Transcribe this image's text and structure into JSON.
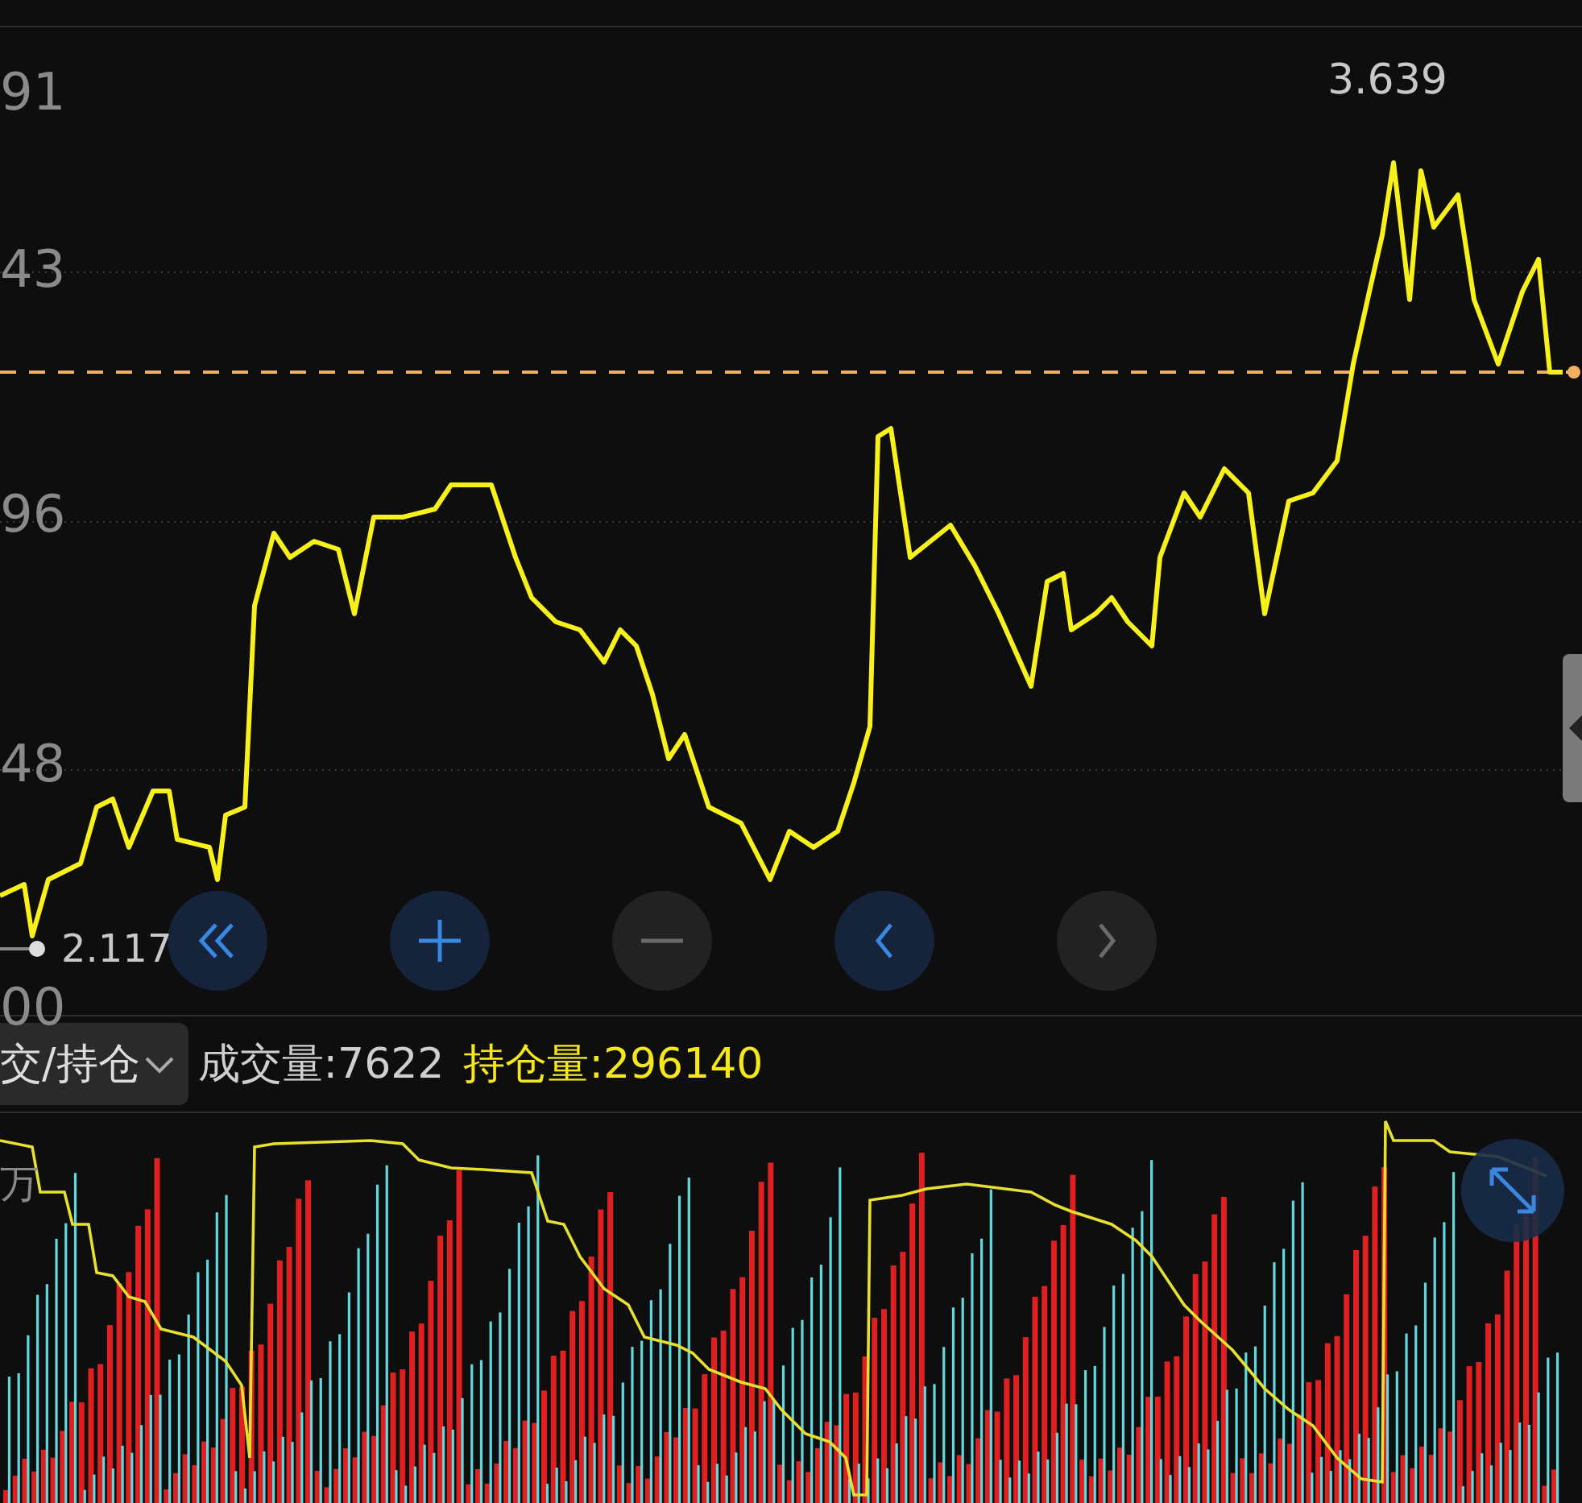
{
  "price_panel": {
    "axis_labels": [
      "91",
      "43",
      "96",
      "48",
      "00"
    ],
    "high_label": "3.639",
    "low_label": "2.117"
  },
  "controls": [
    {
      "kind": "rewind",
      "disabled": false
    },
    {
      "kind": "zoom_in",
      "disabled": false
    },
    {
      "kind": "zoom_out",
      "disabled": true
    },
    {
      "kind": "back",
      "disabled": false
    },
    {
      "kind": "forward",
      "disabled": true
    }
  ],
  "indicator_bar": {
    "selector": "交/持仓",
    "volume": "成交量:7622",
    "open_interest": "持仓量:296140"
  },
  "volume_panel": {
    "unit_label": "万"
  }
}
